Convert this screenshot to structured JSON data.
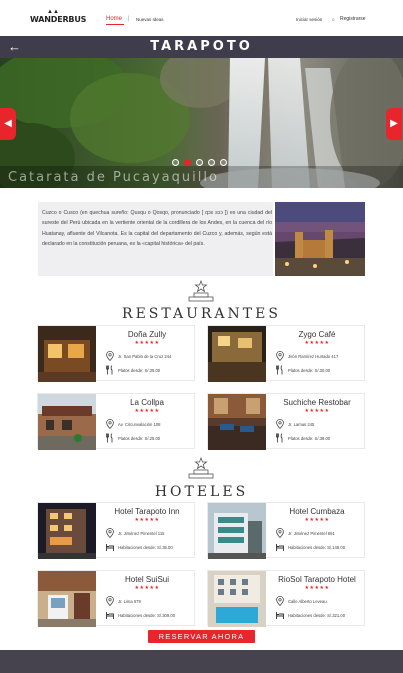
{
  "header": {
    "logo_crest": "▲▲",
    "brand": "WANDERBUS",
    "nav_home": "Home",
    "nav_sep": "|",
    "nav_ideas": "Nuevas Ideas",
    "login": "Iniciar sesión",
    "or": "o",
    "register": "Registrarse"
  },
  "titlebar": {
    "back": "←",
    "title": "TARAPOTO"
  },
  "hero": {
    "caption": "Catarata de Pucayaquillo",
    "left_arrow": "◀",
    "right_arrow": "▶",
    "slide_count": 5,
    "active_slide": 2
  },
  "description": {
    "text": "Cuzco o Cusco (en quechua sureño: Qusqu o Qosqo, pronunciado [ qɔs sɔɔ ]) es una ciudad del sureste del Perú ubicada en la vertiente oriental de la cordillera de los Andes, en la cuenca del río Huatanay, afluente del Vilcanota. Es la capital del departamento del Cuzco y, además, según está declarado en la constitución peruana, es la «capital histórica» del país."
  },
  "restaurants": {
    "title": "RESTAURANTES",
    "items": [
      {
        "name": "Doña Zully",
        "stars": "★★★★★",
        "address": "Jr. San Pablo de la Cruz 244",
        "price": "Platos desde: S/.35.00"
      },
      {
        "name": "Zygo Café",
        "stars": "★★★★★",
        "address": "Jirón Ramírez Hurtado 417",
        "price": "Platos desde: S/.30.00"
      },
      {
        "name": "La Collpa",
        "stars": "★★★★★",
        "address": "Av. Circunvalación 108",
        "price": "Platos desde: S/.25.00"
      },
      {
        "name": "Suchiche Restobar",
        "stars": "★★★★★",
        "address": "Jr. Lamas 245",
        "price": "Platos desde: S/.38.00"
      }
    ]
  },
  "hotels": {
    "title": "HOTELES",
    "items": [
      {
        "name": "Hotel Tarapoto Inn",
        "stars": "★★★★★",
        "address": "Jr. Jiménez Pimentel 115",
        "price": "Habitaciones desde: S/.36.00"
      },
      {
        "name": "Hotel Cumbaza",
        "stars": "★★★★★",
        "address": "Jr. Jiménez Pimentel 691",
        "price": "Habitaciones desde: S/.148.00"
      },
      {
        "name": "Hotel SuiSui",
        "stars": "★★★★★",
        "address": "Jr. Lima 579",
        "price": "Habitaciones desde: S/.309.00"
      },
      {
        "name": "RioSol Tarapoto Hotel",
        "stars": "★★★★★",
        "address": "Calle Alberto Leveau",
        "price": "Habitaciones desde: S/.321.00"
      }
    ]
  },
  "cta": {
    "reserve": "RESERVAR AHORA"
  },
  "colors": {
    "accent": "#e8252b",
    "dark": "#3f3c4c"
  }
}
